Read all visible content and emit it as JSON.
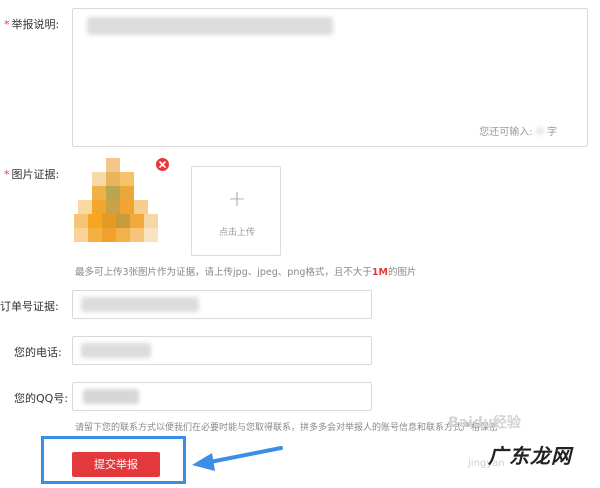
{
  "form": {
    "report_desc": {
      "label": "举报说明:",
      "required_mark": "*",
      "counter_text": "您还可输入:",
      "counter_suffix": "字"
    },
    "image_evidence": {
      "label": "图片证据:",
      "required_mark": "*",
      "upload_plus": "+",
      "upload_label": "点击上传",
      "hint_prefix": "最多可上传3张图片作为证据，请上传jpg、jpeg、png格式，且不大于",
      "hint_size": "1M",
      "hint_suffix": "的图片"
    },
    "order_evidence": {
      "label": "订单号证据:"
    },
    "phone": {
      "label": "您的电话:"
    },
    "qq": {
      "label": "您的QQ号:"
    },
    "contact_hint": "请留下您的联系方式以便我们在必要时能与您取得联系，拼多多会对举报人的账号信息和联系方式严格保密",
    "submit_label": "提交举报"
  },
  "watermark": {
    "brand": "Baidu经验",
    "site": "jingyan",
    "logo_text": "广东龙网"
  },
  "colors": {
    "required": "#e4393c",
    "submit_bg": "#e4393c",
    "highlight_border": "#3a8ee6",
    "arrow": "#3a8ee6"
  }
}
